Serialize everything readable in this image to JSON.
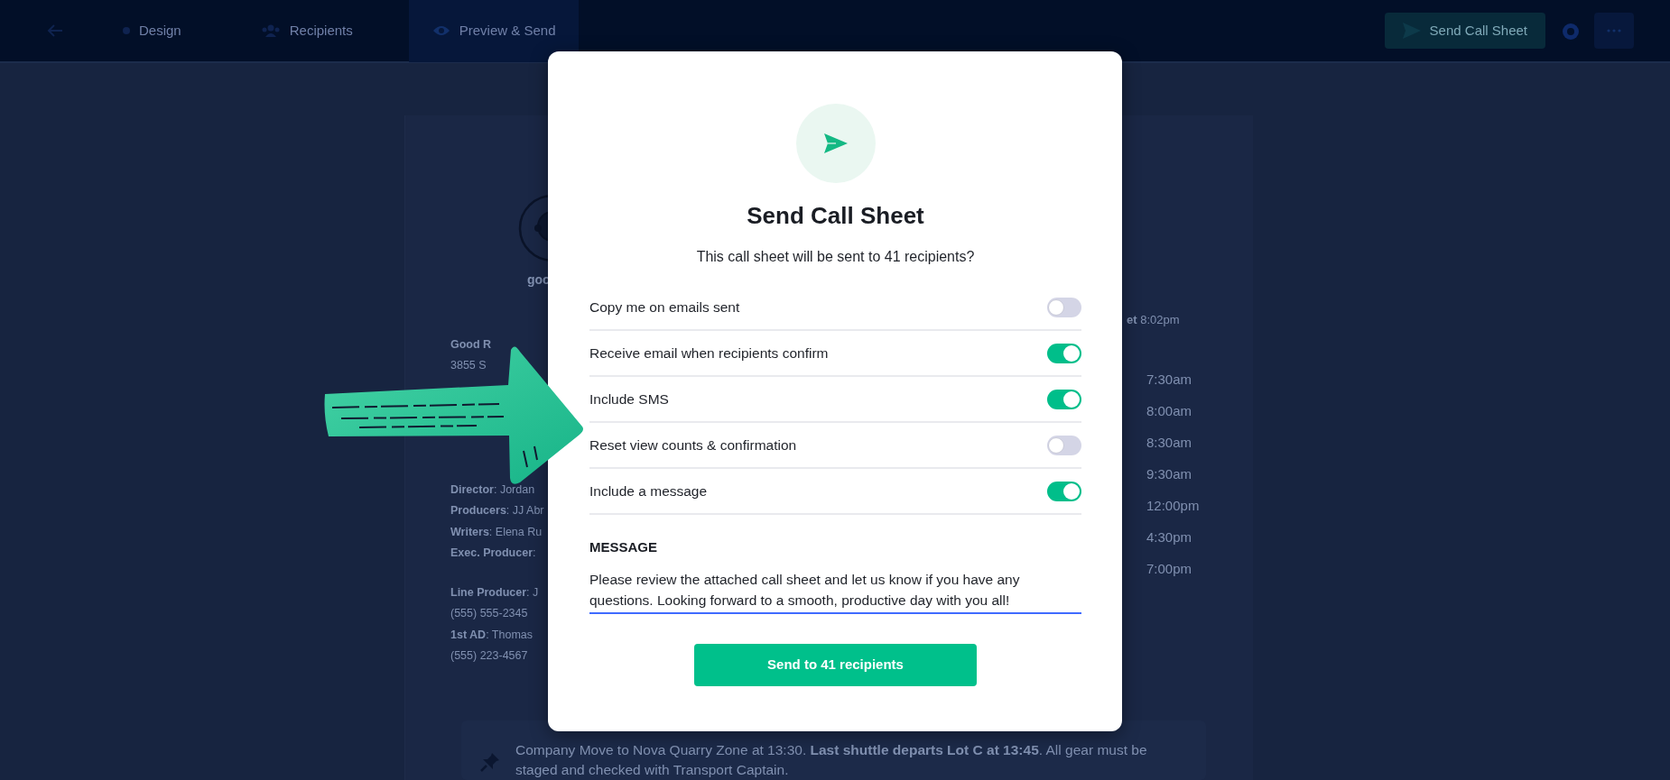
{
  "top_bar": {
    "tabs": [
      {
        "label": "Design",
        "selected": false
      },
      {
        "label": "Recipients",
        "selected": false
      },
      {
        "label": "Preview & Send",
        "selected": true
      }
    ],
    "send_button": "Send Call Sheet"
  },
  "call_sheet": {
    "logo_text": "goo",
    "left_blocks": [
      [
        "**Good R**",
        "3855 S"
      ],
      [
        "**Director**: Jordan",
        "**Producers**: JJ Abr",
        "**Writers**: Elena Ru",
        "**Exec. Producer**:"
      ],
      [
        "**Line Producer**: J",
        "(555) 555-2345",
        "**1st AD**: Thomas",
        "(555) 223-4567"
      ]
    ],
    "sunset": "**et** 8:02pm",
    "times": [
      "7:30am",
      "8:00am",
      "8:30am",
      "9:30am",
      "12:00pm",
      "4:30pm",
      "7:00pm"
    ],
    "note": "Company Move to Nova Quarry Zone at 13:30. **Last shuttle departs Lot C at 13:45**. All gear must be staged and checked with Transport Captain."
  },
  "dialog": {
    "title": "Send Call Sheet",
    "subtitle": "This call sheet will be sent to 41 recipients?",
    "options": [
      {
        "label": "Copy me on emails sent",
        "on": false
      },
      {
        "label": "Receive email when recipients confirm",
        "on": true
      },
      {
        "label": "Include SMS",
        "on": true
      },
      {
        "label": "Reset view counts & confirmation",
        "on": false
      },
      {
        "label": "Include a message",
        "on": true
      }
    ],
    "message_label": "MESSAGE",
    "message": "Please review the attached call sheet and let us know if you have any questions. Looking forward to a smooth, productive day with you all!",
    "send_button": "Send to 41 recipients"
  }
}
